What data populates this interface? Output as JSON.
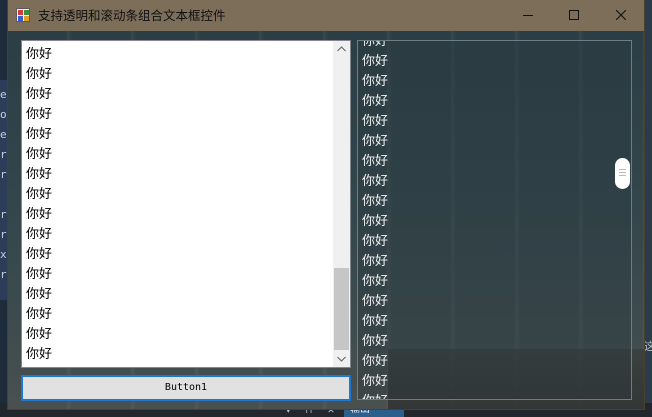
{
  "window": {
    "title": "支持透明和滚动条组合文本框控件",
    "controls": {
      "minimize": "minimize",
      "maximize": "maximize",
      "close": "close"
    }
  },
  "left_listbox": {
    "lines": [
      "你好",
      "你好",
      "你好",
      "你好",
      "你好",
      "你好",
      "你好",
      "你好",
      "你好",
      "你好",
      "你好",
      "你好",
      "你好",
      "你好",
      "你好",
      "你好"
    ]
  },
  "button1": {
    "label": "Button1"
  },
  "right_textbox": {
    "lines": [
      "你好",
      "你好",
      "你好",
      "你好",
      "你好",
      "你好",
      "你好",
      "你好",
      "你好",
      "你好",
      "你好",
      "你好",
      "你好",
      "你好",
      "你好",
      "你好",
      "你好",
      "你好",
      "你好",
      "你好"
    ]
  },
  "background": {
    "left_chars": [
      "e",
      "o",
      "e",
      "re",
      "re",
      "r",
      "ro",
      "x",
      "re"
    ],
    "output_tab": "输出",
    "right_char": "这"
  },
  "colors": {
    "titlebar": "#7c6e58",
    "button_border": "#1e78d2",
    "scroll_thumb": "#c6c6c6"
  }
}
